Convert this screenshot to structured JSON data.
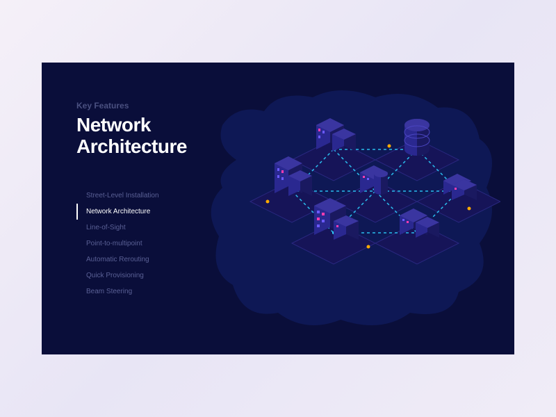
{
  "header": {
    "subtitle": "Key Features",
    "headline_line1": "Network",
    "headline_line2": "Architecture"
  },
  "menu": {
    "items": [
      {
        "label": "Street-Level Installation",
        "active": false
      },
      {
        "label": "Network Architecture",
        "active": true
      },
      {
        "label": "Line-of-Sight",
        "active": false
      },
      {
        "label": "Point-to-multipoint",
        "active": false
      },
      {
        "label": "Automatic Rerouting",
        "active": false
      },
      {
        "label": "Quick Provisioning",
        "active": false
      },
      {
        "label": "Beam Steering",
        "active": false
      }
    ]
  },
  "colors": {
    "panel_bg": "#0a0e3a",
    "cloud_bg": "#0f1a5a",
    "building_dark": "#1a1960",
    "building_light": "#3a35a0",
    "accent_pink": "#ff3db0",
    "accent_cyan": "#2dd0ff",
    "ground": "#161458"
  },
  "diagram": {
    "description": "Isometric city blocks connected by dashed mesh network lines",
    "nodes": 6,
    "connections": "triangulated mesh"
  }
}
